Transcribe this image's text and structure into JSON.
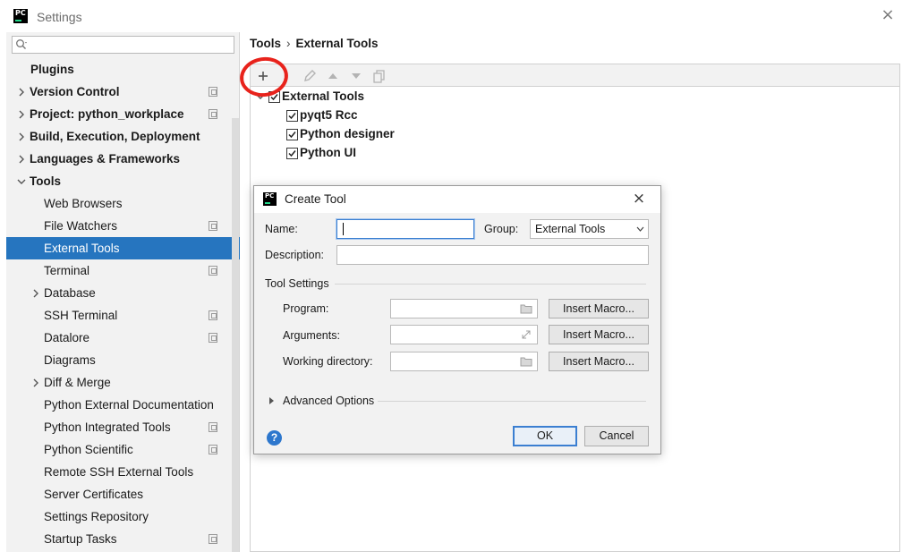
{
  "window": {
    "title": "Settings"
  },
  "search": {
    "placeholder": ""
  },
  "sidebar": {
    "items": [
      {
        "label": "Plugins"
      },
      {
        "label": "Version Control"
      },
      {
        "label": "Project: python_workplace"
      },
      {
        "label": "Build, Execution, Deployment"
      },
      {
        "label": "Languages & Frameworks"
      },
      {
        "label": "Tools"
      },
      {
        "label": "Web Browsers"
      },
      {
        "label": "File Watchers"
      },
      {
        "label": "External Tools"
      },
      {
        "label": "Terminal"
      },
      {
        "label": "Database"
      },
      {
        "label": "SSH Terminal"
      },
      {
        "label": "Datalore"
      },
      {
        "label": "Diagrams"
      },
      {
        "label": "Diff & Merge"
      },
      {
        "label": "Python External Documentation"
      },
      {
        "label": "Python Integrated Tools"
      },
      {
        "label": "Python Scientific"
      },
      {
        "label": "Remote SSH External Tools"
      },
      {
        "label": "Server Certificates"
      },
      {
        "label": "Settings Repository"
      },
      {
        "label": "Startup Tasks"
      }
    ]
  },
  "breadcrumb": {
    "parent": "Tools",
    "separator": "›",
    "current": "External Tools"
  },
  "tools_tree": {
    "group": "External Tools",
    "items": [
      {
        "label": "pyqt5 Rcc",
        "checked": true
      },
      {
        "label": "Python designer",
        "checked": true
      },
      {
        "label": "Python UI",
        "checked": true
      }
    ]
  },
  "dialog": {
    "title": "Create Tool",
    "name_label": "Name:",
    "name_value": "",
    "group_label": "Group:",
    "group_value": "External Tools",
    "description_label": "Description:",
    "description_value": "",
    "tool_settings_label": "Tool Settings",
    "program_label": "Program:",
    "program_value": "",
    "arguments_label": "Arguments:",
    "arguments_value": "",
    "workdir_label": "Working directory:",
    "workdir_value": "",
    "insert_macro_label": "Insert Macro...",
    "advanced_label": "Advanced Options",
    "help_glyph": "?",
    "ok_label": "OK",
    "cancel_label": "Cancel"
  },
  "icons": {
    "app_logo_text": "PC",
    "close_glyph": "×"
  },
  "colors": {
    "selection": "#2675bf",
    "annotation_circle": "#e8231c",
    "focus_border": "#3b7fd1"
  }
}
